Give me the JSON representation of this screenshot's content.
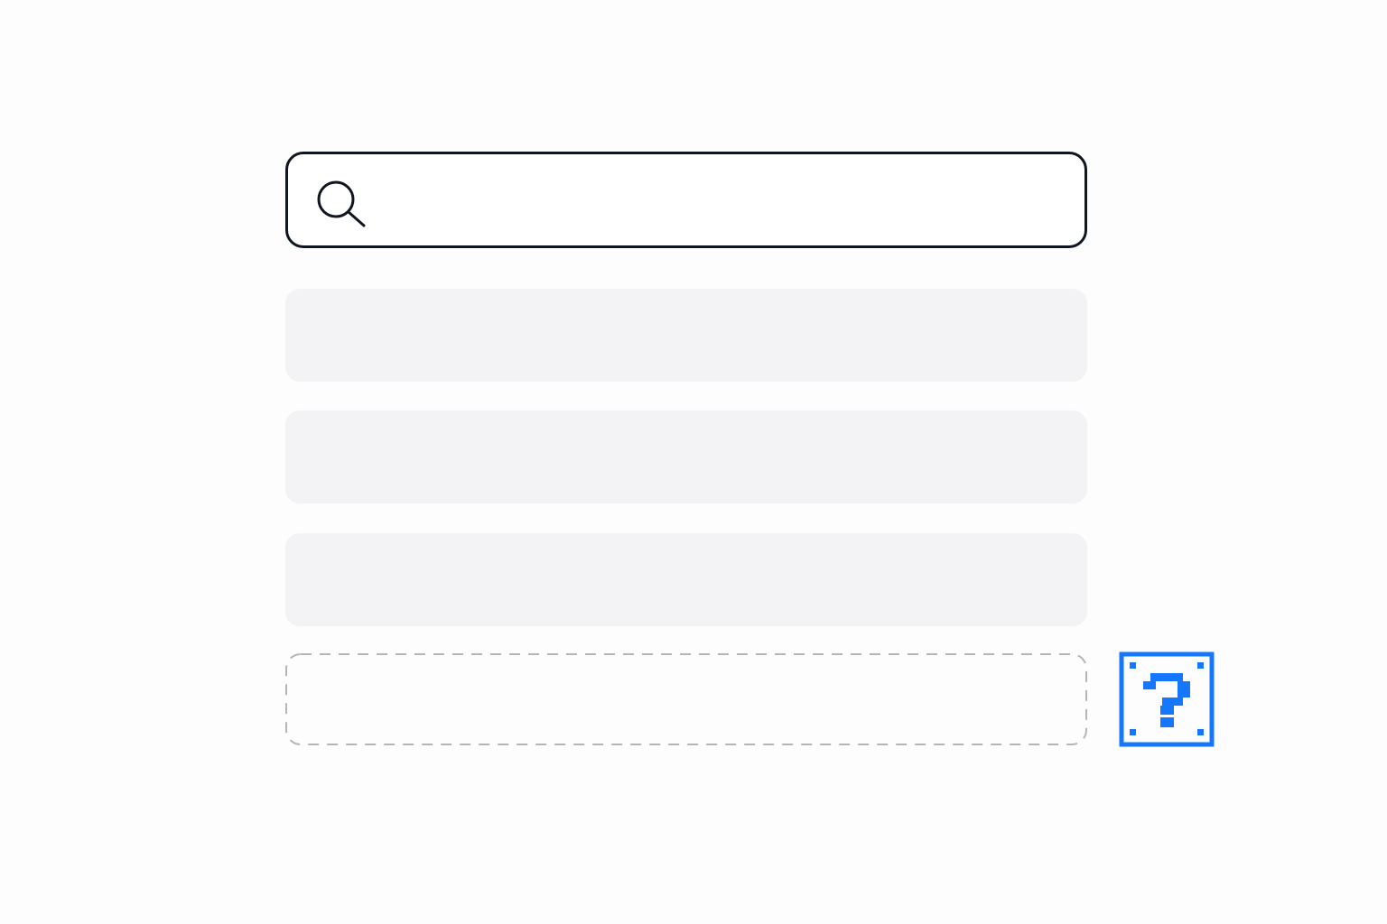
{
  "search": {
    "value": "",
    "placeholder": "",
    "icon": "search-icon"
  },
  "results": {
    "item_count": 3,
    "state": "loading-skeleton"
  },
  "empty_slot": {
    "style": "dashed"
  },
  "help": {
    "icon": "question-block-icon",
    "glyph": "?"
  },
  "colors": {
    "background": "#fdfdfd",
    "search_border": "#101620",
    "skeleton": "#f3f3f5",
    "dashed_border": "#b5b5b5",
    "accent": "#1577fe"
  }
}
